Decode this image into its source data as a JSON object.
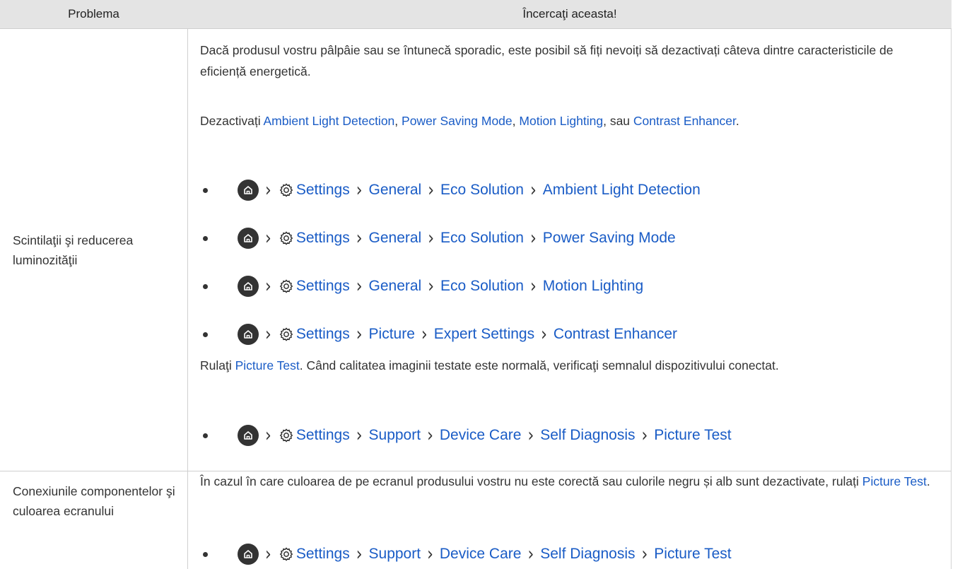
{
  "header": {
    "col_problem": "Problema",
    "col_solution": "Încercaţi aceasta!"
  },
  "rows": [
    {
      "problem": "Scintilaţii şi reducerea luminozităţii",
      "para1": "Dacă produsul vostru pâlpâie sau se întunecă sporadic, este posibil să fiți nevoiți să dezactivați câteva dintre caracteristicile de eficiență energetică.",
      "para2": {
        "prefix": "Dezactivați ",
        "link1": "Ambient Light Detection",
        "sep1": ", ",
        "link2": "Power Saving Mode",
        "sep2": ", ",
        "link3": "Motion Lighting",
        "sep3": ", sau ",
        "link4": "Contrast Enhancer",
        "suffix": "."
      },
      "paths": [
        [
          "Settings",
          "General",
          "Eco Solution",
          "Ambient Light Detection"
        ],
        [
          "Settings",
          "General",
          "Eco Solution",
          "Power Saving Mode"
        ],
        [
          "Settings",
          "General",
          "Eco Solution",
          "Motion Lighting"
        ],
        [
          "Settings",
          "Picture",
          "Expert Settings",
          "Contrast Enhancer"
        ]
      ],
      "para3": {
        "prefix": "Rulaţi ",
        "link": "Picture Test",
        "suffix": ". Când calitatea imaginii testate este normală, verificaţi semnalul dispozitivului conectat."
      },
      "path_last": [
        "Settings",
        "Support",
        "Device Care",
        "Self Diagnosis",
        "Picture Test"
      ]
    },
    {
      "problem": "Conexiunile componentelor şi culoarea ecranului",
      "para1": {
        "prefix": "În cazul în care culoarea de pe ecranul produsului vostru nu este corectă sau culorile negru și alb sunt dezactivate, rulați ",
        "link": "Picture Test",
        "suffix": "."
      },
      "path": [
        "Settings",
        "Support",
        "Device Care",
        "Self Diagnosis",
        "Picture Test"
      ]
    }
  ],
  "colors": {
    "link": "#1a5cc6",
    "header_bg": "#e4e4e4",
    "border": "#cfcfcf"
  },
  "icons": {
    "home": "home-icon",
    "settings": "gear-icon",
    "separator": "chevron-right-icon"
  }
}
